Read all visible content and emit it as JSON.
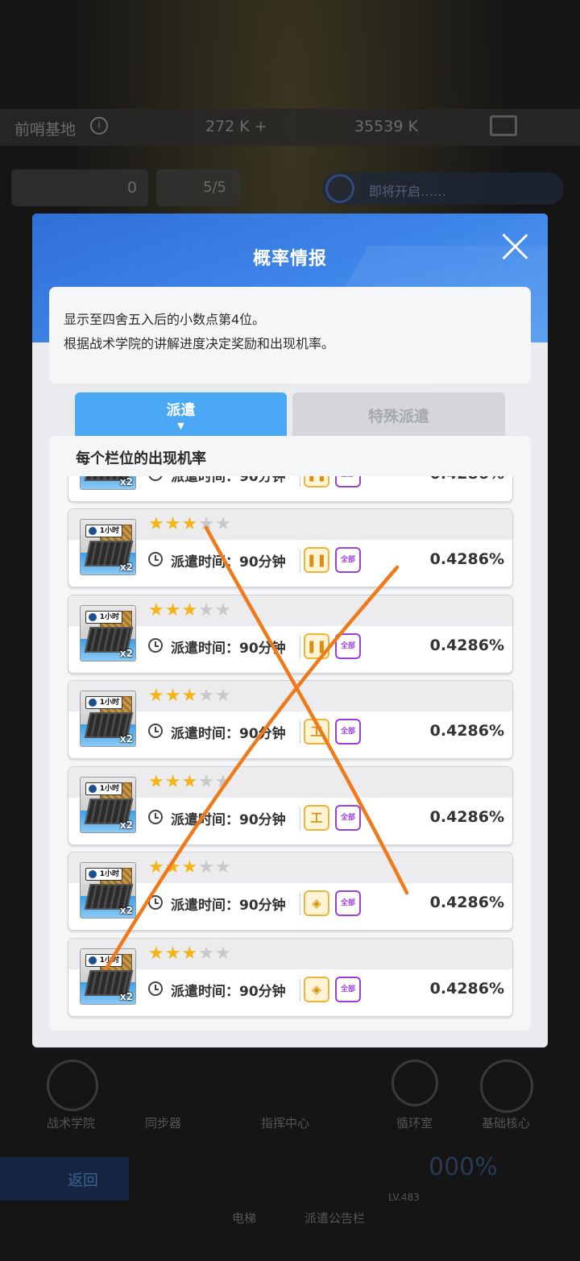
{
  "background": {
    "base_name": "前哨基地",
    "resource_1": "272 K +",
    "resource_2": "35539 K",
    "counter_1": "0",
    "counter_2": "5/5",
    "banner_text": "即将开启……",
    "bottom_labels": [
      "战术学院",
      "同步器",
      "指挥中心",
      "循环室",
      "基础核心"
    ],
    "back_label": "返回",
    "bottom_labels_2": [
      "电梯",
      "派遣公告栏"
    ],
    "level": "LV.483",
    "percent": "000%"
  },
  "modal": {
    "title": "概率情报",
    "notice_line1": "显示至四舍五入后的小数点第4位。",
    "notice_line2": "根据战术学院的讲解进度决定奖励和出现机率。",
    "tabs": [
      {
        "label": "派遣",
        "active": true,
        "caret": "▼"
      },
      {
        "label": "特殊派遣",
        "active": false
      }
    ],
    "list_heading": "每个栏位的出现机率"
  },
  "items": [
    {
      "tag": "1小时",
      "qty": "x2",
      "stars_on": 3,
      "stars_total": 5,
      "dispatch_text": "派遣时间：90分钟",
      "type_glyph": "❚❚",
      "type": "lamp-icon",
      "badge": "全部",
      "rate": "0.4286%"
    },
    {
      "tag": "1小时",
      "qty": "x2",
      "stars_on": 3,
      "stars_total": 5,
      "dispatch_text": "派遣时间：90分钟",
      "type_glyph": "❚❚",
      "type": "lamp-icon",
      "badge": "全部",
      "rate": "0.4286%"
    },
    {
      "tag": "1小时",
      "qty": "x2",
      "stars_on": 3,
      "stars_total": 5,
      "dispatch_text": "派遣时间：90分钟",
      "type_glyph": "工",
      "type": "anvil-icon",
      "badge": "全部",
      "rate": "0.4286%"
    },
    {
      "tag": "1小时",
      "qty": "x2",
      "stars_on": 3,
      "stars_total": 5,
      "dispatch_text": "派遣时间：90分钟",
      "type_glyph": "工",
      "type": "anvil-icon",
      "badge": "全部",
      "rate": "0.4286%"
    },
    {
      "tag": "1小时",
      "qty": "x2",
      "stars_on": 3,
      "stars_total": 5,
      "dispatch_text": "派遣时间：90分钟",
      "type_glyph": "◈",
      "type": "diamond-icon",
      "badge": "全部",
      "rate": "0.4286%"
    },
    {
      "tag": "1小时",
      "qty": "x2",
      "stars_on": 3,
      "stars_total": 5,
      "dispatch_text": "派遣时间：90分钟",
      "type_glyph": "◈",
      "type": "diamond-icon",
      "badge": "全部",
      "rate": "0.4286%"
    }
  ],
  "colors": {
    "header_blue": "#3f86ea",
    "tab_active": "#4aa8f5",
    "star_on": "#f4b41a",
    "badge_purple": "#9b3fe3",
    "type_gold": "#f3b23a",
    "annotation_orange": "#f07a1a"
  }
}
